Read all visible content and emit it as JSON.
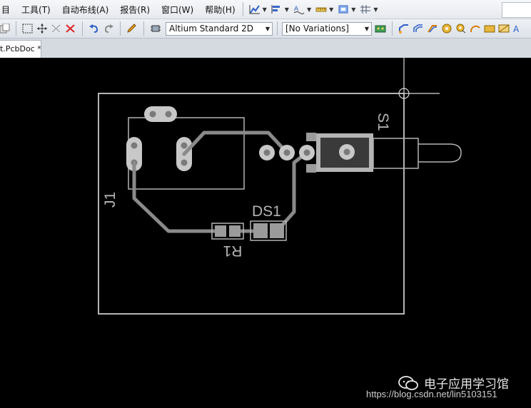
{
  "menu": {
    "items": [
      {
        "label": "工具(T)",
        "name": "menu-tools"
      },
      {
        "label": "自动布线(A)",
        "name": "menu-autoroute"
      },
      {
        "label": "报告(R)",
        "name": "menu-reports"
      },
      {
        "label": "窗口(W)",
        "name": "menu-window"
      },
      {
        "label": "帮助(H)",
        "name": "menu-help"
      }
    ],
    "partial_left": "目"
  },
  "toolbar": {
    "view_mode": "Altium Standard 2D",
    "variations": "[No Variations]"
  },
  "tabs": {
    "document": "t.PcbDoc *"
  },
  "pcb": {
    "designators": {
      "J1": "J1",
      "S1": "S1",
      "DS1": "DS1",
      "R1": "R1"
    },
    "colors": {
      "board_outline": "#b4b4b4",
      "silkscreen": "#b4b4b4",
      "track": "#8a8a8a",
      "pad": "#c8c8c8",
      "pad_hole": "#7a7a7a",
      "component_body": "#9b9b9b"
    }
  },
  "watermark": {
    "title": "电子应用学习馆",
    "url": "https://blog.csdn.net/lin5103151"
  }
}
